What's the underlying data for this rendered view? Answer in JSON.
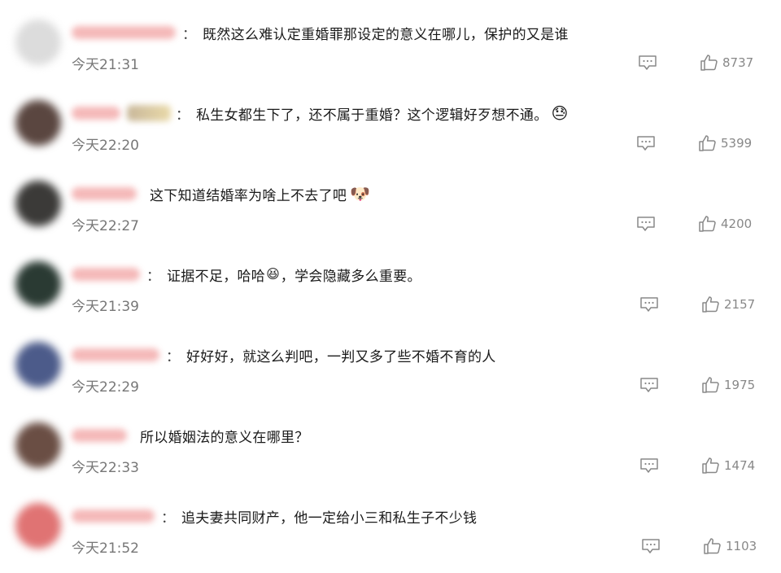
{
  "comments": [
    {
      "text": "既然这么难认定重婚罪那设定的意义在哪儿，保护的又是谁",
      "time": "今天21:31",
      "likes": "8737",
      "avatar_color": "#d9d9d9",
      "colon": "："
    },
    {
      "text": "私生女都生下了，还不属于重婚？这个逻辑好歹想不通。",
      "time": "今天22:20",
      "likes": "5399",
      "avatar_color": "#5a4640",
      "colon": "：",
      "emoji": "😓"
    },
    {
      "text": "这下知道结婚率为啥上不去了吧",
      "time": "今天22:27",
      "likes": "4200",
      "avatar_color": "#3b3a38",
      "colon": "",
      "emoji": "🐶"
    },
    {
      "text_before": "证据不足，哈哈",
      "emoji": "😆",
      "text_after": "，学会隐藏多么重要。",
      "time": "今天21:39",
      "likes": "2157",
      "avatar_color": "#2a3a33",
      "colon": "："
    },
    {
      "text": "好好好，就这么判吧，一判又多了些不婚不育的人",
      "time": "今天22:29",
      "likes": "1975",
      "avatar_color": "#4c5b8a",
      "colon": "："
    },
    {
      "text": "所以婚姻法的意义在哪里？",
      "time": "今天22:33",
      "likes": "1474",
      "avatar_color": "#6a4e44",
      "colon": ""
    },
    {
      "text": "追夫妻共同财产，他一定给小三和私生子不少钱",
      "time": "今天21:52",
      "likes": "1103",
      "avatar_color": "#e07373",
      "colon": "："
    }
  ]
}
